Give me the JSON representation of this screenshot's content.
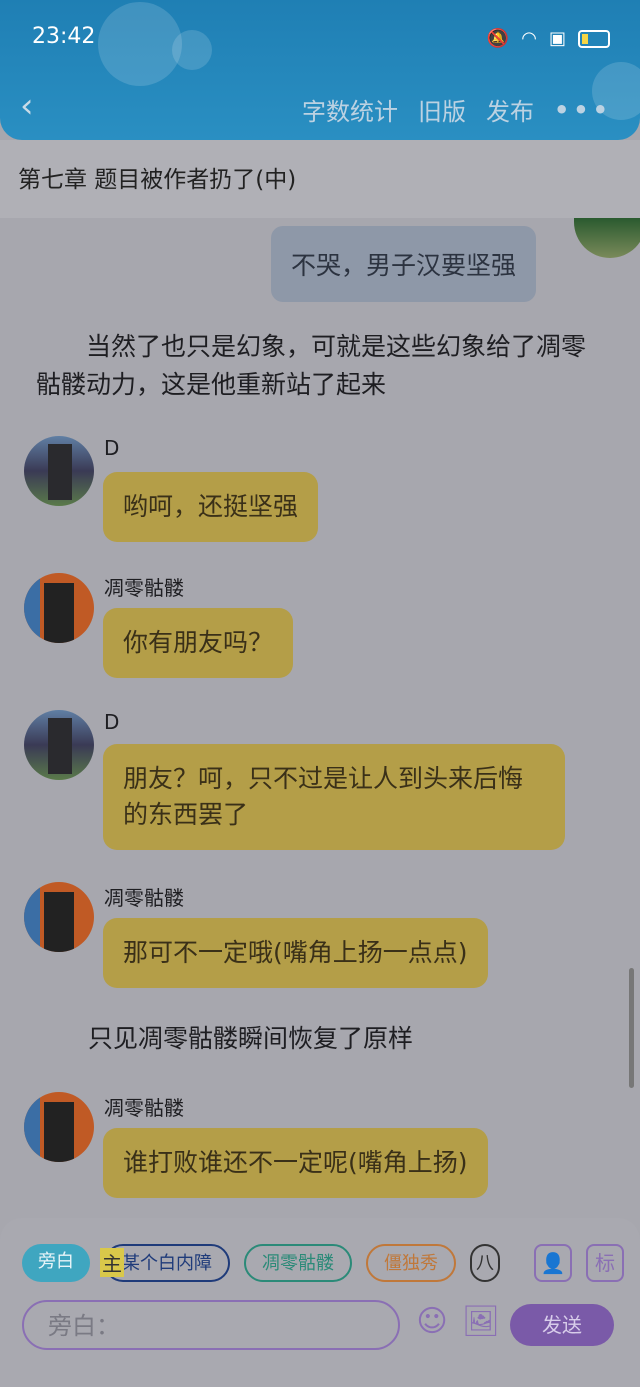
{
  "status": {
    "time": "23:42"
  },
  "nav": {
    "back": "‹",
    "word_count": "字数统计",
    "old_version": "旧版",
    "publish": "发布",
    "more": "•••"
  },
  "chapter_title": "第七章 题目被作者扔了(中)",
  "messages": [
    {
      "type": "right",
      "text": "不哭，男子汉要坚强"
    },
    {
      "type": "narration",
      "text": "当然了也只是幻象，可就是这些幻象给了凋零骷髅动力，这是他重新站了起来"
    },
    {
      "type": "left",
      "name": "D",
      "text": "哟呵，还挺坚强"
    },
    {
      "type": "left",
      "name": "凋零骷髅",
      "text": "你有朋友吗？"
    },
    {
      "type": "left",
      "name": "D",
      "text": "朋友？呵，只不过是让人到头来后悔的东西罢了"
    },
    {
      "type": "left",
      "name": "凋零骷髅",
      "text": "那可不一定哦(嘴角上扬一点点)"
    },
    {
      "type": "narration",
      "text": "只见凋零骷髅瞬间恢复了原样"
    },
    {
      "type": "left",
      "name": "凋零骷髅",
      "text": "谁打败谁还不一定呢(嘴角上扬)"
    }
  ],
  "bottom": {
    "chips": [
      "旁白",
      "某个白内障",
      "凋零骷髅",
      "僵独秀",
      "八"
    ],
    "host_mark": "主",
    "icon_label": "标",
    "input_placeholder": "旁白：",
    "send": "发送"
  }
}
